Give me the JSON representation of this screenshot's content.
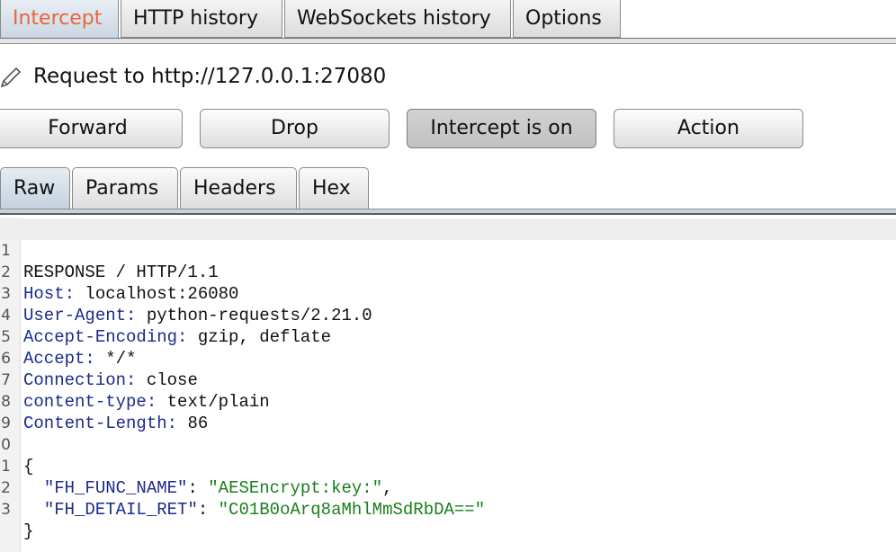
{
  "tabs": [
    "Intercept",
    "HTTP history",
    "WebSockets history",
    "Options"
  ],
  "active_tab": "Intercept",
  "request": {
    "label": "Request to http://127.0.0.1:27080"
  },
  "buttons": {
    "forward": "Forward",
    "drop": "Drop",
    "intercept": "Intercept is on",
    "action": "Action"
  },
  "editor_tabs": [
    "Raw",
    "Params",
    "Headers",
    "Hex"
  ],
  "active_editor_tab": "Raw",
  "editor": {
    "line_numbers": [
      "1",
      "2",
      "3",
      "4",
      "5",
      "6",
      "7",
      "8",
      "9",
      "0",
      "1",
      "2",
      "3"
    ],
    "lines": {
      "l1": "RESPONSE / HTTP/1.1",
      "l2_name": "Host",
      "l2_value": " localhost:26080",
      "l3_name": "User-Agent",
      "l3_value": " python-requests/2.21.0",
      "l4_name": "Accept-Encoding",
      "l4_value": " gzip, deflate",
      "l5_name": "Accept",
      "l5_value": " */*",
      "l6_name": "Connection",
      "l6_value": " close",
      "l7_name": "content-type",
      "l7_value": " text/plain",
      "l8_name": "Content-Length",
      "l8_value": " 86",
      "l10": "{",
      "l11_key": "\"FH_FUNC_NAME\"",
      "l11_value": "\"AESEncrypt:key:\"",
      "l12_key": "\"FH_DETAIL_RET\"",
      "l12_value": "\"C01B0oArq8aMhlMmSdRbDA==\"",
      "l13": "}"
    }
  },
  "colors": {
    "active_tab_text": "#e8663a",
    "header_name": "#1b2b8a",
    "string_value": "#1a7f1a"
  },
  "icons": {
    "request_icon": "pencil-icon"
  }
}
